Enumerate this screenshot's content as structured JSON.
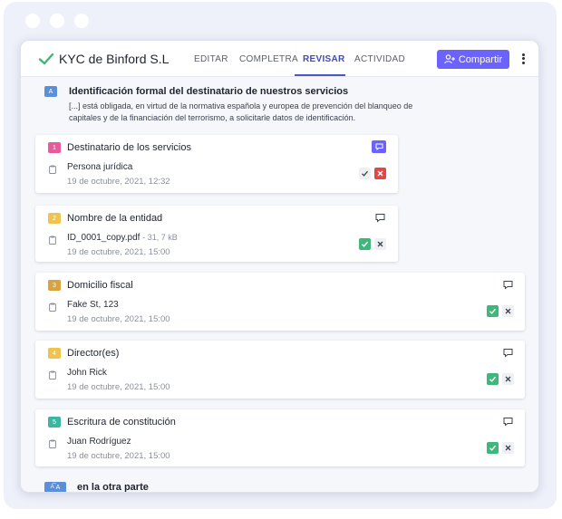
{
  "colors": {
    "accent": "#6c63ff",
    "success": "#3fb67a",
    "danger": "#e04848",
    "badge_a": "#5b8fd8",
    "badge_1": "#e85a9b",
    "badge_2": "#f0c34a",
    "badge_3": "#d9a23a",
    "badge_4": "#f0c34a",
    "badge_5": "#3bb6a0"
  },
  "header": {
    "title": "KYC de Binford S.L",
    "tabs": [
      {
        "label": "EDITAR",
        "active": false
      },
      {
        "label": "COMPLETRA",
        "active": false
      },
      {
        "label": "REVISAR",
        "active": true
      },
      {
        "label": "ACTIVIDAD",
        "active": false
      }
    ],
    "share_label": "Compartir",
    "share_icon": "add-user-icon",
    "more_icon": "vertical-dots-icon"
  },
  "section": {
    "badge": "A",
    "title": "Identificación formal del destinatario de nuestros servicios",
    "description": "[...] está obligada, en virtud de la normativa española y europea de prevención del blanqueo de capitales y de la financiación del terrorismo, a solicitarle datos de identificación."
  },
  "cards": [
    {
      "num": "1",
      "title": "Destinatario de los servicios",
      "value": "Persona jurídica",
      "size": "",
      "date": "19 de octubre, 2021, 12:32",
      "approved": false,
      "rejected": true
    },
    {
      "num": "2",
      "title": "Nombre de la entidad",
      "value": "ID_0001_copy.pdf",
      "size": "- 31, 7 kB",
      "date": "19 de octubre, 2021, 15:00",
      "approved": true,
      "rejected": false
    },
    {
      "num": "3",
      "title": "Domicilio fiscal",
      "value": "Fake St, 123",
      "size": "",
      "date": "19 de octubre, 2021, 15:00",
      "approved": true,
      "rejected": false
    },
    {
      "num": "4",
      "title": "Director(es)",
      "value": "John Rick",
      "size": "",
      "date": "19 de octubre, 2021, 15:00",
      "approved": true,
      "rejected": false
    },
    {
      "num": "5",
      "title": "Escritura de constitución",
      "value": "Juan Rodríguez",
      "size": "",
      "date": "19 de octubre, 2021, 15:00",
      "approved": true,
      "rejected": false
    }
  ],
  "next_section": {
    "badge": "A",
    "title": "en la otra parte"
  }
}
